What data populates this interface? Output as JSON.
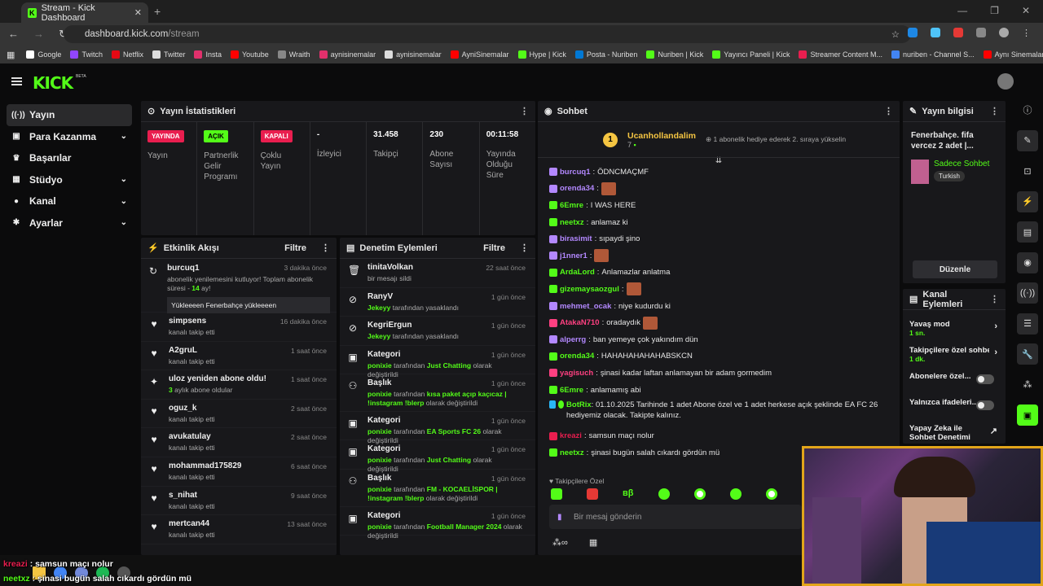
{
  "browser": {
    "tab_title": "Stream - Kick Dashboard",
    "url_host": "dashboard.kick.com",
    "url_path": "/stream",
    "bookmarks": [
      {
        "label": "Google",
        "color": "#ffffff"
      },
      {
        "label": "Twitch",
        "color": "#9146ff"
      },
      {
        "label": "Netflix",
        "color": "#e50914"
      },
      {
        "label": "Twitter",
        "color": "#dddddd"
      },
      {
        "label": "Insta",
        "color": "#e1306c"
      },
      {
        "label": "Youtube",
        "color": "#ff0000"
      },
      {
        "label": "Wraith",
        "color": "#888888"
      },
      {
        "label": "aynisinemalar",
        "color": "#e1306c"
      },
      {
        "label": "aynisinemalar",
        "color": "#dddddd"
      },
      {
        "label": "AyniSinemalar",
        "color": "#ff0000"
      },
      {
        "label": "Hype | Kick",
        "color": "#53fc18"
      },
      {
        "label": "Posta - Nuriben",
        "color": "#0078d4"
      },
      {
        "label": "Nuriben | Kick",
        "color": "#53fc18"
      },
      {
        "label": "Yayıncı Paneli | Kick",
        "color": "#53fc18"
      },
      {
        "label": "Streamer Content M...",
        "color": "#e91e4f"
      },
      {
        "label": "nuriben - Channel S...",
        "color": "#4285f4"
      },
      {
        "label": "Aynı Sinemalar - Ça...",
        "color": "#ff0000"
      }
    ]
  },
  "sidebar": {
    "items": [
      {
        "label": "Yayın",
        "icon": "broadcast-icon",
        "has_chevron": false
      },
      {
        "label": "Para Kazanma",
        "icon": "money-icon",
        "has_chevron": true
      },
      {
        "label": "Başarılar",
        "icon": "trophy-icon",
        "has_chevron": false
      },
      {
        "label": "Stüdyo",
        "icon": "studio-icon",
        "has_chevron": true
      },
      {
        "label": "Kanal",
        "icon": "user-icon",
        "has_chevron": true
      },
      {
        "label": "Ayarlar",
        "icon": "gear-icon",
        "has_chevron": true
      }
    ]
  },
  "stats": {
    "title": "Yayın İstatistikleri",
    "cols": [
      {
        "badge": "YAYINDA",
        "badge_color": "#e91e4f",
        "value": "",
        "label": "Yayın"
      },
      {
        "badge": "AÇIK",
        "badge_color": "#53fc18",
        "value": "",
        "label": "Partnerlik Gelir Programı"
      },
      {
        "badge": "KAPALI",
        "badge_color": "#e91e4f",
        "value": "",
        "label": "Çoklu Yayın"
      },
      {
        "badge": "",
        "value": "-",
        "label": "İzleyici"
      },
      {
        "badge": "",
        "value": "31.458",
        "label": "Takipçi"
      },
      {
        "badge": "",
        "value": "230",
        "label": "Abone Sayısı"
      },
      {
        "badge": "",
        "value": "00:11:58",
        "label": "Yayında Olduğu Süre"
      }
    ]
  },
  "events": {
    "title": "Etkinlik Akışı",
    "filter": "Filtre",
    "first": {
      "name": "burcuq1",
      "time": "3 dakika önce",
      "sub_pre": "abonelik yenilemesini kutluyor! Toplam abonelik süresi - ",
      "sub_num": "14",
      "sub_post": " ay!",
      "quote": "Yükleeeen Fenerbahçe yükleeeen"
    },
    "items": [
      {
        "name": "simpsens",
        "time": "16 dakika önce",
        "sub": "kanalı takip etti"
      },
      {
        "name": "A2gruL",
        "time": "1 saat önce",
        "sub": "kanalı takip etti"
      },
      {
        "name": "uloz yeniden abone oldu!",
        "time": "1 saat önce",
        "sub": "aylık abone oldular",
        "sub_num": "3"
      },
      {
        "name": "oguz_k",
        "time": "2 saat önce",
        "sub": "kanalı takip etti"
      },
      {
        "name": "avukatulay",
        "time": "2 saat önce",
        "sub": "kanalı takip etti"
      },
      {
        "name": "mohammad175829",
        "time": "6 saat önce",
        "sub": "kanalı takip etti"
      },
      {
        "name": "s_nihat",
        "time": "9 saat önce",
        "sub": "kanalı takip etti"
      },
      {
        "name": "mertcan44",
        "time": "13 saat önce",
        "sub": "kanalı takip etti"
      }
    ]
  },
  "moderation": {
    "title": "Denetim Eylemleri",
    "filter": "Filtre",
    "items": [
      {
        "name": "tinitaVolkan",
        "time": "22 saat önce",
        "actor": "",
        "pre": "bir mesajı sildi",
        "target": "",
        "post": ""
      },
      {
        "name": "RanyV",
        "time": "1 gün önce",
        "actor": "Jekeyy",
        "pre": " tarafından yasaklandı",
        "target": "",
        "post": ""
      },
      {
        "name": "KegriErgun",
        "time": "1 gün önce",
        "actor": "Jekeyy",
        "pre": " tarafından yasaklandı",
        "target": "",
        "post": ""
      },
      {
        "name": "Kategori",
        "time": "1 gün önce",
        "actor": "ponixie",
        "pre": " tarafından ",
        "target": "Just Chatting",
        "post": " olarak değiştirildi"
      },
      {
        "name": "Başlık",
        "time": "1 gün önce",
        "actor": "ponixie",
        "pre": " tarafından ",
        "target": "kısa paket açıp kaçıcaz | !instagram !blerp",
        "post": " olarak değiştirildi"
      },
      {
        "name": "Kategori",
        "time": "1 gün önce",
        "actor": "ponixie",
        "pre": " tarafından ",
        "target": "EA Sports FC 26",
        "post": " olarak değiştirildi"
      },
      {
        "name": "Kategori",
        "time": "1 gün önce",
        "actor": "ponixie",
        "pre": " tarafından ",
        "target": "Just Chatting",
        "post": " olarak değiştirildi"
      },
      {
        "name": "Başlık",
        "time": "1 gün önce",
        "actor": "ponixie",
        "pre": " tarafından ",
        "target": "FM - KOCAELİSPOR | !instagram !blerp",
        "post": " olarak değiştirildi"
      },
      {
        "name": "Kategori",
        "time": "1 gün önce",
        "actor": "ponixie",
        "pre": " tarafından ",
        "target": "Football Manager 2024",
        "post": " olarak değiştirildi"
      }
    ]
  },
  "chat": {
    "title": "Sohbet",
    "pinned_user": "Ucanhollandalim",
    "pinned_count": "7",
    "pinned_msg": "1 abonelik hediye ederek 2. sıraya yükselin",
    "lines": [
      {
        "user": "burcuq1",
        "color": "#b388ff",
        "msg": "ÖDNCMAÇMF",
        "emote": false
      },
      {
        "user": "orenda34",
        "color": "#b388ff",
        "msg": "",
        "emote": true
      },
      {
        "user": "6Emre",
        "color": "#53fc18",
        "msg": "I WAS HERE",
        "emote": false
      },
      {
        "user": "neetxz",
        "color": "#53fc18",
        "msg": "anlamaz ki",
        "emote": false
      },
      {
        "user": "birasimit",
        "color": "#b388ff",
        "msg": "sıpaydi şino",
        "emote": false
      },
      {
        "user": "j1nner1",
        "color": "#b388ff",
        "msg": "",
        "emote": true
      },
      {
        "user": "ArdaLord",
        "color": "#53fc18",
        "msg": "Anlamazlar anlatma",
        "emote": false
      },
      {
        "user": "gizemaysaozgul",
        "color": "#53fc18",
        "msg": "",
        "emote": true
      },
      {
        "user": "mehmet_ocak",
        "color": "#b388ff",
        "msg": "niye kudurdu ki",
        "emote": false
      },
      {
        "user": "AtakaN710",
        "color": "#ff4081",
        "msg": "oradaydık",
        "emote": true
      },
      {
        "user": "alperrg",
        "color": "#b388ff",
        "msg": "ban yemeye çok yakındım dün",
        "emote": false
      },
      {
        "user": "orenda34",
        "color": "#53fc18",
        "msg": "HAHAHAHAHAHABSKCN",
        "emote": false
      },
      {
        "user": "yagisuch",
        "color": "#ff4081",
        "msg": "şinasi kadar laftan anlamayan bir adam gormedim",
        "emote": false
      },
      {
        "user": "6Emre",
        "color": "#53fc18",
        "msg": "anlamamış abi",
        "emote": false
      }
    ],
    "bot_user": "BotRix",
    "bot_msg": "01.10.2025 Tarihinde 1 adet Abone özel ve 1 adet herkese açık şeklinde EA FC 26 hediyemiz olacak. Takipte kalınız.",
    "lines2": [
      {
        "user": "kreazi",
        "color": "#e91e4f",
        "msg": "samsun maçı nolur"
      },
      {
        "user": "neetxz",
        "color": "#53fc18",
        "msg": "şinasi bugün salah cıkardı gördün mü"
      }
    ],
    "followers_only": "Takipçilere Özel",
    "input_placeholder": "Bir mesaj gönderin"
  },
  "stream_info": {
    "title": "Yayın bilgisi",
    "stream_title": "Fenerbahçe. fifa vercez 2 adet |...",
    "category": "Sadece Sohbet",
    "language": "Turkish",
    "edit": "Düzenle"
  },
  "channel_actions": {
    "title": "Kanal Eylemleri",
    "items": [
      {
        "label": "Yavaş mod",
        "value": "1 sn.",
        "kind": "arrow"
      },
      {
        "label": "Takipçilere özel sohbe",
        "value": "1 dk.",
        "kind": "arrow"
      },
      {
        "label": "Abonelere özel...",
        "value": "",
        "kind": "toggle"
      },
      {
        "label": "Yalnızca ifadeleri...",
        "value": "",
        "kind": "toggle"
      },
      {
        "label": "Yapay Zeka ile Sohbet Denetimi",
        "value": "",
        "kind": "link"
      }
    ]
  },
  "overlay": {
    "line1_user": "kreazi",
    "line1_msg": " : samsun maçı nolur",
    "line2_user": "neetxz",
    "line2_msg": " : şinasi bugün salah cıkardı gördün mü"
  }
}
